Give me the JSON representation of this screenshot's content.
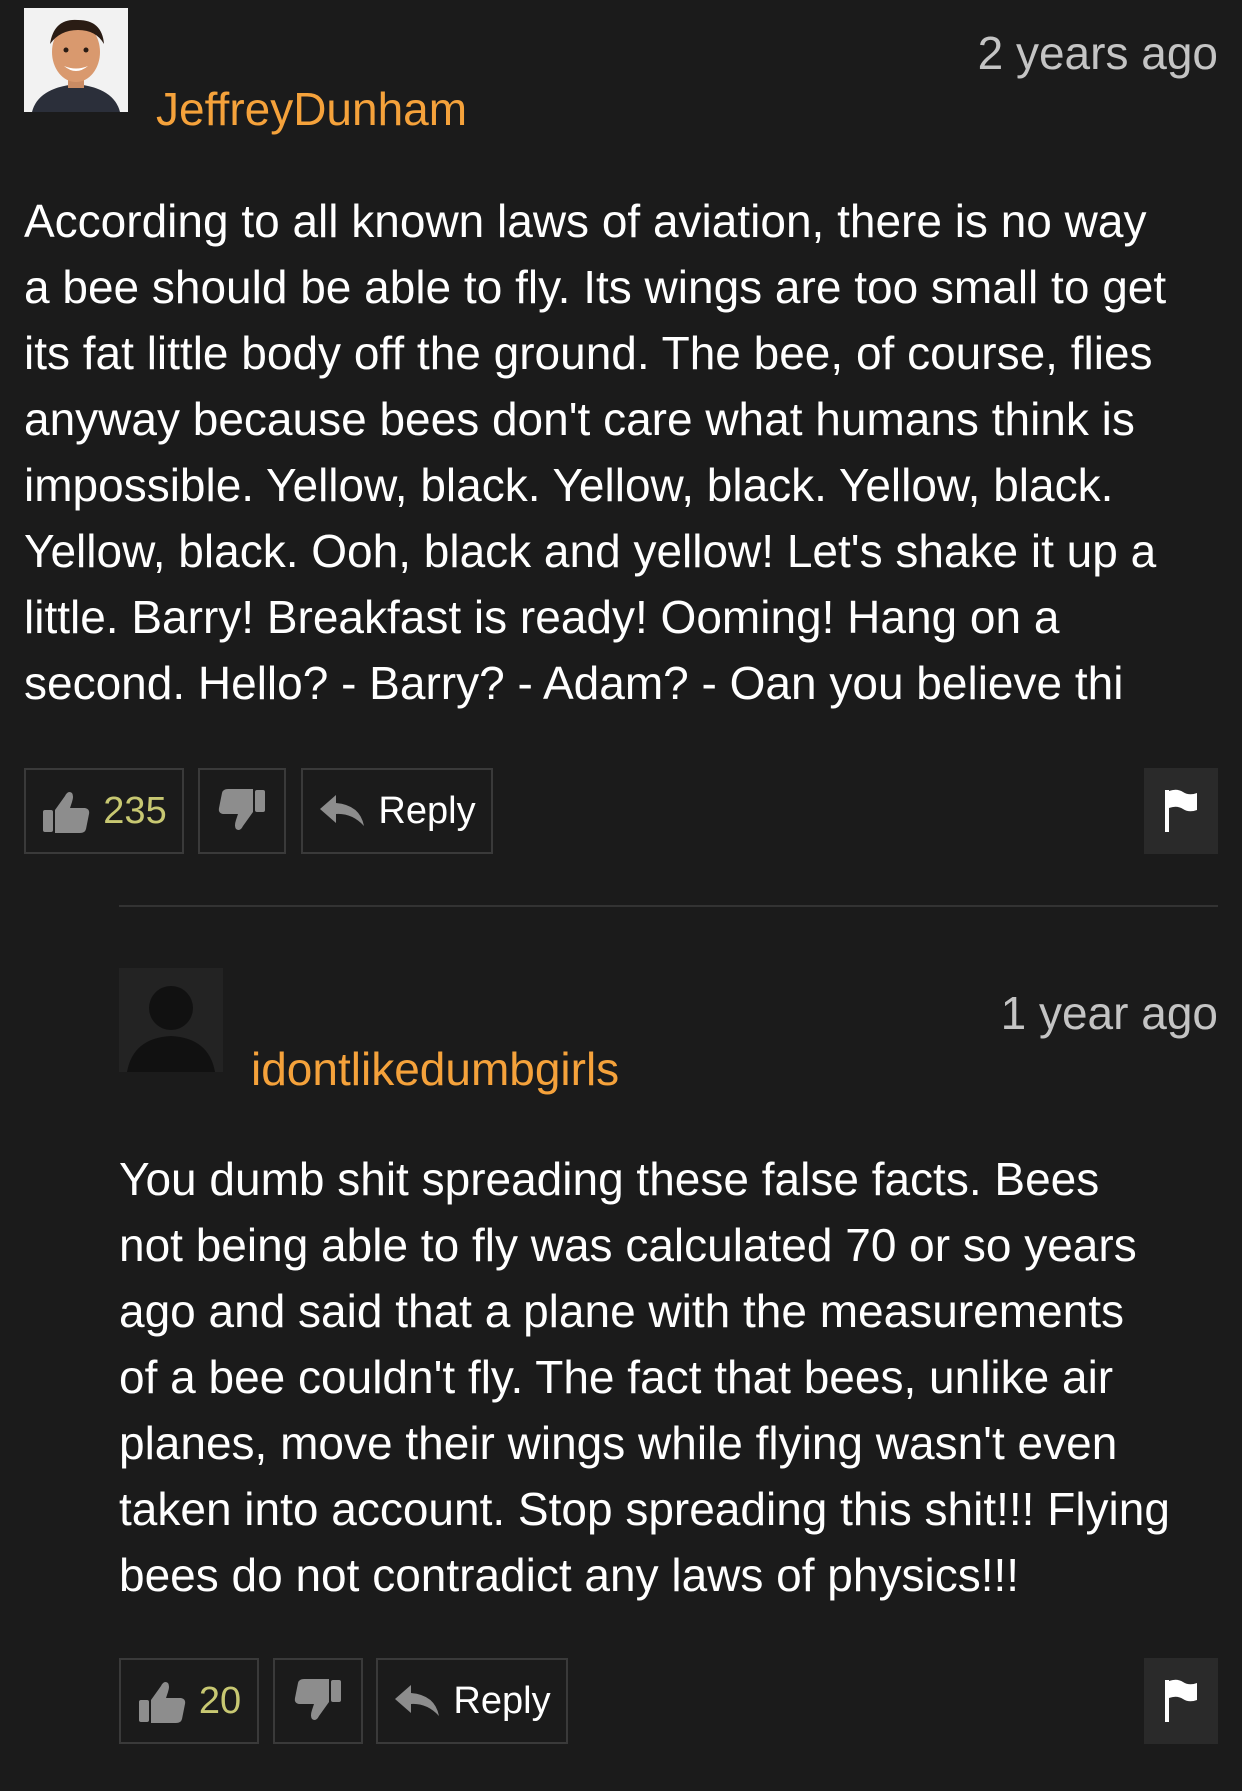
{
  "comments": [
    {
      "username": "JeffreyDunham",
      "timestamp": "2 years ago",
      "body": "According to all known laws of aviation, there is no way\na bee should be able to fly. Its wings are too small to get\nits fat little body off the ground. The bee, of course, flies\nanyway because bees don't care what humans think is\nimpossible. Yellow, black. Yellow, black. Yellow, black.\nYellow, black. Ooh, black and yellow! Let's shake it up a\nlittle. Barry! Breakfast is ready! Ooming! Hang on a\nsecond. Hello? - Barry? - Adam? - Oan you believe thi",
      "likes": "235",
      "reply_label": "Reply"
    },
    {
      "username": "idontlikedumbgirls",
      "timestamp": "1 year ago",
      "body": "You dumb shit spreading these false facts. Bees\nnot being able to fly was calculated 70 or so years\nago and said that a plane with the measurements\nof a bee couldn't fly. The fact that bees, unlike air\nplanes, move their wings while flying wasn't even\ntaken into account. Stop spreading this shit!!! Flying\nbees do not contradict any laws of physics!!!",
      "likes": "20",
      "reply_label": "Reply"
    }
  ],
  "colors": {
    "background": "#1b1b1b",
    "username": "#f5a23b",
    "timestamp": "#c4c4c4",
    "like_count": "#c8c872",
    "button_border": "#3a3a3a"
  },
  "icons": {
    "like": "thumbs-up-icon",
    "dislike": "thumbs-down-icon",
    "reply": "reply-arrow-icon",
    "flag": "flag-icon"
  }
}
